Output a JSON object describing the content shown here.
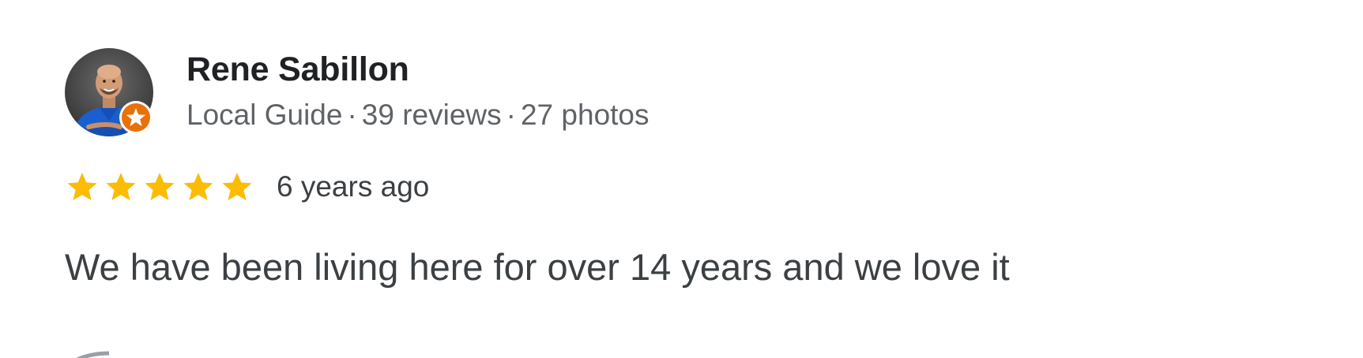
{
  "reviewer": {
    "name": "Rene Sabillon",
    "badge": "Local Guide",
    "separator": "·",
    "reviews": "39 reviews",
    "photos": "27 photos",
    "badge_color": "#e8710a",
    "avatar_shirt_color": "#1a5fd0"
  },
  "review": {
    "rating": 5,
    "max_rating": 5,
    "star_color": "#fbbc04",
    "date": "6 years ago",
    "text": "We have been living here for over 14 years and we love it"
  }
}
